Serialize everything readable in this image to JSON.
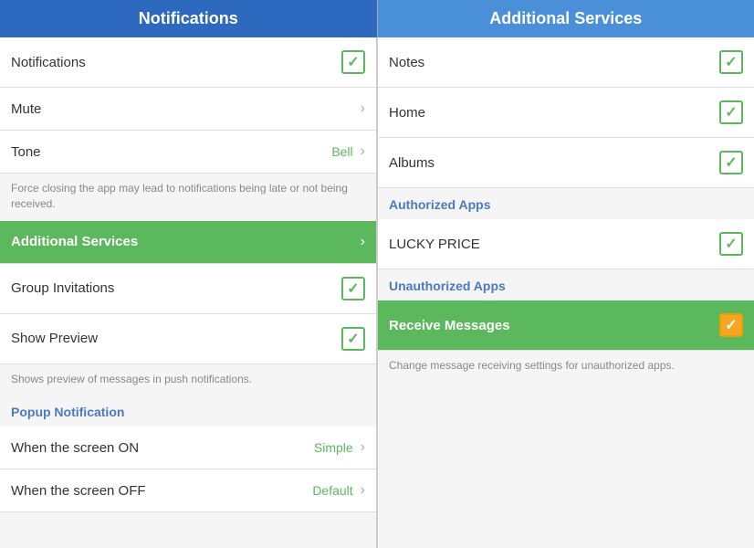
{
  "leftHeader": {
    "title": "Notifications"
  },
  "rightHeader": {
    "title": "Additional Services"
  },
  "leftPanel": {
    "items": [
      {
        "id": "notifications",
        "label": "Notifications",
        "type": "checkbox",
        "checked": true
      },
      {
        "id": "mute",
        "label": "Mute",
        "type": "chevron"
      },
      {
        "id": "tone",
        "label": "Tone",
        "type": "value-chevron",
        "value": "Bell"
      }
    ],
    "notice": "Force closing the app may lead to notifications being late or not being received.",
    "additionalServices": {
      "label": "Additional Services",
      "type": "green-chevron"
    },
    "subItems": [
      {
        "id": "group-invitations",
        "label": "Group Invitations",
        "type": "checkbox",
        "checked": true
      },
      {
        "id": "show-preview",
        "label": "Show Preview",
        "type": "checkbox",
        "checked": true
      }
    ],
    "showPreviewNotice": "Shows preview of messages in push notifications.",
    "popupSection": {
      "label": "Popup Notification"
    },
    "popupItems": [
      {
        "id": "screen-on",
        "label": "When the screen ON",
        "type": "value-chevron",
        "value": "Simple"
      },
      {
        "id": "screen-off",
        "label": "When the screen OFF",
        "type": "value-chevron",
        "value": "Default"
      }
    ]
  },
  "rightPanel": {
    "mainItems": [
      {
        "id": "notes",
        "label": "Notes",
        "type": "checkbox",
        "checked": true
      },
      {
        "id": "home",
        "label": "Home",
        "type": "checkbox",
        "checked": true
      },
      {
        "id": "albums",
        "label": "Albums",
        "type": "checkbox",
        "checked": true
      }
    ],
    "authorizedSection": {
      "label": "Authorized Apps"
    },
    "authorizedItems": [
      {
        "id": "lucky-price",
        "label": "LUCKY PRICE",
        "type": "checkbox",
        "checked": true
      }
    ],
    "unauthorizedSection": {
      "label": "Unauthorized Apps"
    },
    "unauthorizedItems": [
      {
        "id": "receive-messages",
        "label": "Receive Messages",
        "type": "checkbox-orange",
        "checked": true,
        "highlighted": true
      }
    ],
    "receiveNotice": "Change message receiving settings for unauthorized apps."
  },
  "icons": {
    "checkmark": "✓",
    "chevron": "›"
  }
}
